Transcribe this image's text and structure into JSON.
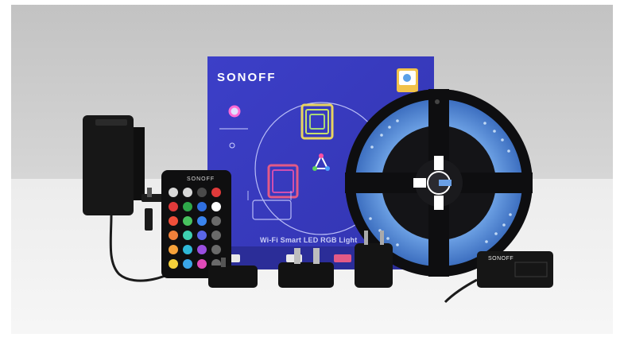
{
  "photo": {
    "subject": "Sonoff Wi-Fi Smart LED RGB light strip kit product photo",
    "colors": {
      "backdrop_top": "#c6c6c6",
      "tabletop": "#f1f1f1",
      "box_blue": "#3b3dc4",
      "strip_led": "#6aa0e6",
      "device_black": "#151515"
    }
  },
  "box": {
    "brand": "SONOFF",
    "product_name": "Wi-Fi Smart LED RGB Light"
  },
  "remote": {
    "brand": "SONOFF"
  },
  "controller": {
    "brand": "SONOFF"
  }
}
